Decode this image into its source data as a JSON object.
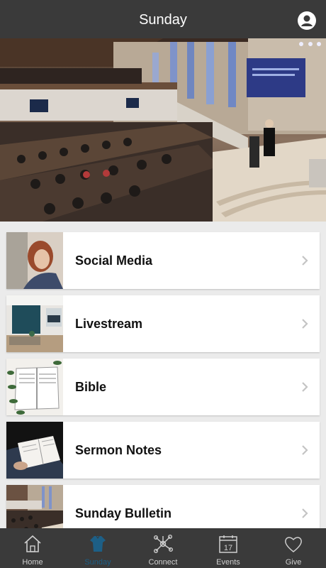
{
  "header": {
    "title": "Sunday",
    "profile_icon": "user-profile-icon"
  },
  "hero": {
    "description_icon": "church-sanctuary-photo"
  },
  "menu": {
    "items": [
      {
        "label": "Social Media",
        "icon": "social-media-photo"
      },
      {
        "label": "Livestream",
        "icon": "livestream-photo"
      },
      {
        "label": "Bible",
        "icon": "bible-photo"
      },
      {
        "label": "Sermon Notes",
        "icon": "sermon-notes-photo"
      },
      {
        "label": "Sunday Bulletin",
        "icon": "sunday-bulletin-photo"
      }
    ]
  },
  "tabs": [
    {
      "label": "Home",
      "icon": "home-icon"
    },
    {
      "label": "Sunday",
      "icon": "shirt-icon",
      "active": true
    },
    {
      "label": "Connect",
      "icon": "network-icon"
    },
    {
      "label": "Events",
      "icon": "calendar-icon",
      "day": "17"
    },
    {
      "label": "Give",
      "icon": "heart-icon"
    }
  ],
  "colors": {
    "bar": "#3a3a3a",
    "active_tab": "#1d5f86",
    "inactive_tab": "#cfcfcf"
  }
}
